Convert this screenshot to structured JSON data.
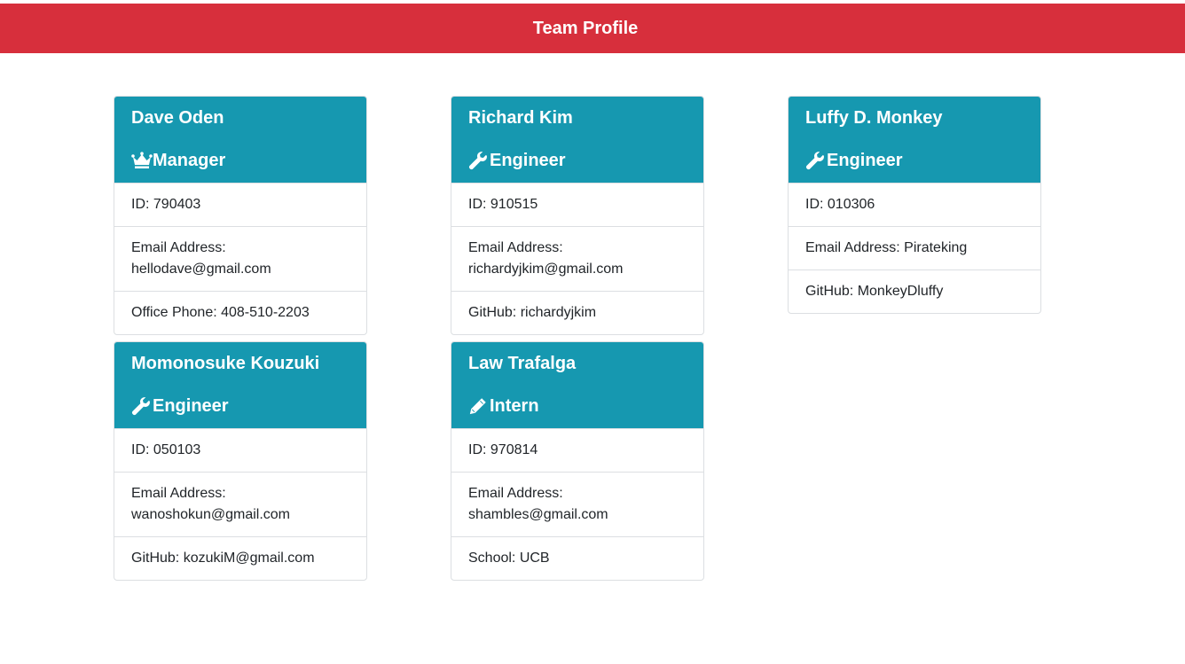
{
  "header": {
    "title": "Team Profile"
  },
  "colors": {
    "header": "#d72f3c",
    "card_header": "#1698b0"
  },
  "cards": [
    {
      "name": "Dave Oden",
      "role": "Manager",
      "role_icon": "crown-icon",
      "id_label": "ID: ",
      "id": "790403",
      "email_label": "Email Address:",
      "email": "hellodave@gmail.com",
      "extra_label": "Office Phone: ",
      "extra": "408-510-2203"
    },
    {
      "name": "Richard Kim",
      "role": "Engineer",
      "role_icon": "wrench-icon",
      "id_label": "ID: ",
      "id": "910515",
      "email_label": "Email Address:",
      "email": "richardyjkim@gmail.com",
      "extra_label": "GitHub: ",
      "extra": "richardyjkim"
    },
    {
      "name": "Luffy D. Monkey",
      "role": "Engineer",
      "role_icon": "wrench-icon",
      "id_label": "ID: ",
      "id": "010306",
      "email_label": "Email Address: ",
      "email": "Pirateking",
      "extra_label": "GitHub: ",
      "extra": "MonkeyDluffy"
    },
    {
      "name": "Momonosuke Kouzuki",
      "role": "Engineer",
      "role_icon": "wrench-icon",
      "id_label": "ID: ",
      "id": "050103",
      "email_label": "Email Address:",
      "email": "wanoshokun@gmail.com",
      "extra_label": "GitHub: ",
      "extra": "kozukiM@gmail.com"
    },
    {
      "name": "Law Trafalga",
      "role": "Intern",
      "role_icon": "pencil-icon",
      "id_label": "ID: ",
      "id": "970814",
      "email_label": "Email Address:",
      "email": "shambles@gmail.com",
      "extra_label": "School: ",
      "extra": "UCB"
    }
  ]
}
